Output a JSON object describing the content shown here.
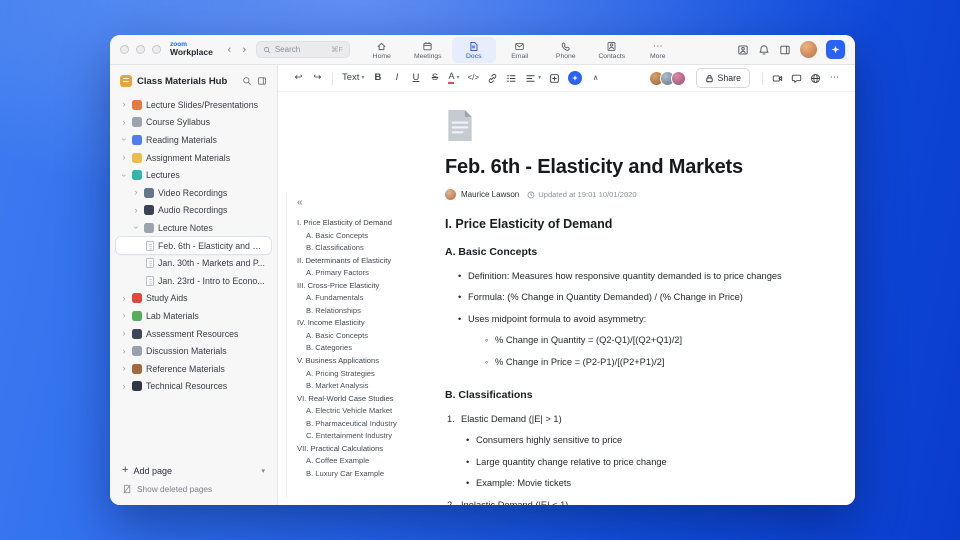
{
  "window": {
    "logo_top": "zoom",
    "logo_bottom": "Workplace",
    "search": {
      "placeholder": "Search",
      "shortcut": "⌘F"
    },
    "nav_tabs": [
      {
        "label": "Home"
      },
      {
        "label": "Meetings"
      },
      {
        "label": "Docs"
      },
      {
        "label": "Email"
      },
      {
        "label": "Phone"
      },
      {
        "label": "Contacts"
      },
      {
        "label": "More"
      }
    ]
  },
  "icons": {
    "back": "‹",
    "forward": "›",
    "tree": "›",
    "chevron_down": "▾",
    "undo": "↩",
    "redo": "↪",
    "bold": "B",
    "italic": "I",
    "underline": "U",
    "strikethrough": "S",
    "font_color": "A",
    "code": "</>",
    "more": "⋯",
    "collapse_toolbar": "∧",
    "outline_collapse": "«",
    "plus": "+"
  },
  "sidebar": {
    "title": "Class Materials Hub",
    "items": [
      {
        "label": "Lecture Slides/Presentations"
      },
      {
        "label": "Course Syllabus"
      },
      {
        "label": "Reading Materials"
      },
      {
        "label": "Assignment Materials"
      },
      {
        "label": "Lectures"
      },
      {
        "label": "Video Recordings"
      },
      {
        "label": "Audio Recordings"
      },
      {
        "label": "Lecture Notes"
      },
      {
        "label": "Feb. 6th - Elasticity and M..."
      },
      {
        "label": "Jan. 30th - Markets and P..."
      },
      {
        "label": "Jan. 23rd - Intro to Econo..."
      },
      {
        "label": "Study Aids"
      },
      {
        "label": "Lab Materials"
      },
      {
        "label": "Assessment Resources"
      },
      {
        "label": "Discussion Materials"
      },
      {
        "label": "Reference Materials"
      },
      {
        "label": "Technical Resources"
      }
    ],
    "footer": {
      "add_page": "Add page",
      "show_deleted": "Show deleted pages"
    }
  },
  "toolbar": {
    "text_style": "Text",
    "share_label": "Share"
  },
  "document": {
    "title": "Feb. 6th - Elasticity and Markets",
    "author": "Maurice Lawson",
    "updated": "Updated at 19:01 10/01/2020",
    "outline": [
      {
        "text": "I. Price Elasticity of Demand"
      },
      {
        "text": "A. Basic Concepts"
      },
      {
        "text": "B. Classifications"
      },
      {
        "text": "II. Determinants of Elasticity"
      },
      {
        "text": "A. Primary Factors"
      },
      {
        "text": "III. Cross-Price Elasticity"
      },
      {
        "text": "A. Fundamentals"
      },
      {
        "text": "B. Relationships"
      },
      {
        "text": "IV. Income Elasticity"
      },
      {
        "text": "A. Basic Concepts"
      },
      {
        "text": "B. Categories"
      },
      {
        "text": "V. Business Applications"
      },
      {
        "text": "A. Pricing Strategies"
      },
      {
        "text": "B. Market Analysis"
      },
      {
        "text": "VI. Real-World Case Studies"
      },
      {
        "text": "A. Electric Vehicle Market"
      },
      {
        "text": "B. Pharmaceutical Industry"
      },
      {
        "text": "C. Entertainment Industry"
      },
      {
        "text": "VII. Practical Calculations"
      },
      {
        "text": "A. Coffee Example"
      },
      {
        "text": "B. Luxury Car Example"
      }
    ],
    "content": [
      {
        "text": "I. Price Elasticity of Demand"
      },
      {
        "text": "A. Basic Concepts"
      },
      {
        "text": "Definition: Measures how responsive quantity demanded is to price changes"
      },
      {
        "text": "Formula: (% Change in Quantity Demanded) / (% Change in Price)"
      },
      {
        "text": "Uses midpoint formula to avoid asymmetry:"
      },
      {
        "text": "% Change in Quantity = (Q2-Q1)/[(Q2+Q1)/2]"
      },
      {
        "text": "% Change in Price = (P2-P1)/[(P2+P1)/2]"
      },
      {
        "text": "B. Classifications"
      },
      {
        "n": "1.",
        "text": "Elastic Demand (|E| > 1)"
      },
      {
        "text": "Consumers highly sensitive to price"
      },
      {
        "text": "Large quantity change relative to price change"
      },
      {
        "text": "Example: Movie tickets"
      },
      {
        "n": "2.",
        "text": "Inelastic Demand (|E| < 1)"
      }
    ]
  }
}
